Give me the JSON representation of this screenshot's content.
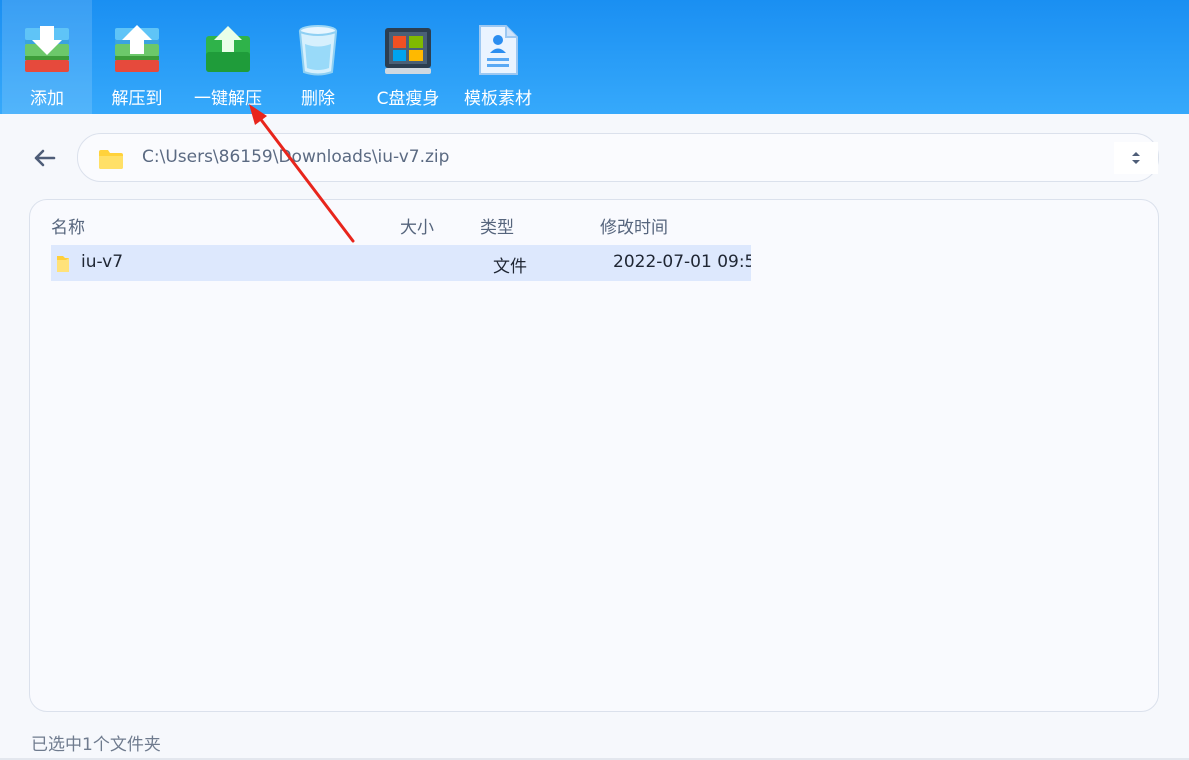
{
  "toolbar": {
    "items": [
      {
        "label": "添加",
        "icon": "add-archive-icon"
      },
      {
        "label": "解压到",
        "icon": "extract-to-icon"
      },
      {
        "label": "一键解压",
        "icon": "one-click-extract-icon"
      },
      {
        "label": "删除",
        "icon": "trash-icon"
      },
      {
        "label": "C盘瘦身",
        "icon": "windows-disk-icon"
      },
      {
        "label": "模板素材",
        "icon": "template-document-icon"
      }
    ],
    "active_index": 0
  },
  "pathbar": {
    "path": "C:\\Users\\86159\\Downloads\\iu-v7.zip"
  },
  "file_list": {
    "columns": [
      "名称",
      "大小",
      "类型",
      "修改时间"
    ],
    "rows": [
      {
        "name": "iu-v7",
        "size": "",
        "type": "文件",
        "modified": "2022-07-01 09:5"
      }
    ]
  },
  "status": {
    "text": "已选中1个文件夹"
  },
  "colors": {
    "toolbar_blue": "#1a8ff2",
    "selection": "#dde8fd",
    "annotation_arrow": "#e8251c"
  }
}
